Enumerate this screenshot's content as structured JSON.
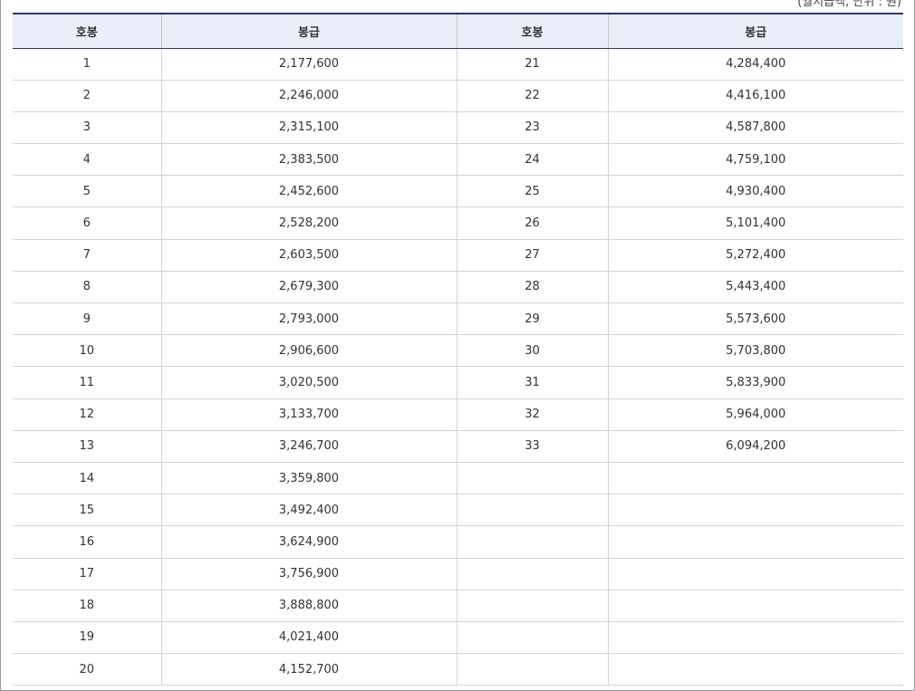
{
  "note": "(월지급액, 단위 : 원)",
  "headers": [
    "호봉",
    "봉급",
    "호봉",
    "봉급"
  ],
  "rows": [
    [
      "1",
      "2,177,600",
      "21",
      "4,284,400"
    ],
    [
      "2",
      "2,246,000",
      "22",
      "4,416,100"
    ],
    [
      "3",
      "2,315,100",
      "23",
      "4,587,800"
    ],
    [
      "4",
      "2,383,500",
      "24",
      "4,759,100"
    ],
    [
      "5",
      "2,452,600",
      "25",
      "4,930,400"
    ],
    [
      "6",
      "2,528,200",
      "26",
      "5,101,400"
    ],
    [
      "7",
      "2,603,500",
      "27",
      "5,272,400"
    ],
    [
      "8",
      "2,679,300",
      "28",
      "5,443,400"
    ],
    [
      "9",
      "2,793,000",
      "29",
      "5,573,600"
    ],
    [
      "10",
      "2,906,600",
      "30",
      "5,703,800"
    ],
    [
      "11",
      "3,020,500",
      "31",
      "5,833,900"
    ],
    [
      "12",
      "3,133,700",
      "32",
      "5,964,000"
    ],
    [
      "13",
      "3,246,700",
      "33",
      "6,094,200"
    ],
    [
      "14",
      "3,359,800",
      "",
      ""
    ],
    [
      "15",
      "3,492,400",
      "",
      ""
    ],
    [
      "16",
      "3,624,900",
      "",
      ""
    ],
    [
      "17",
      "3,756,900",
      "",
      ""
    ],
    [
      "18",
      "3,888,800",
      "",
      ""
    ],
    [
      "19",
      "4,021,400",
      "",
      ""
    ],
    [
      "20",
      "4,152,700",
      "",
      ""
    ]
  ]
}
